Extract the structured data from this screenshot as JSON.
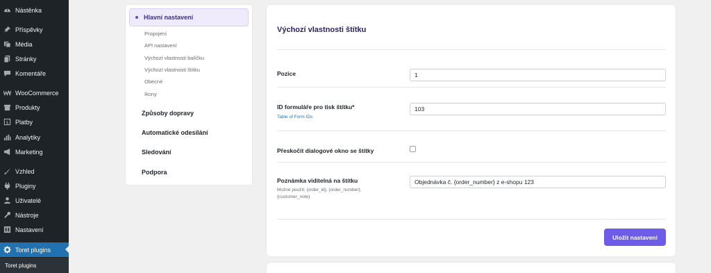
{
  "sidebar": {
    "items": [
      {
        "label": "Nástěnka",
        "icon": "dashboard-icon"
      },
      {
        "label": "Příspěvky",
        "icon": "pin-icon"
      },
      {
        "label": "Média",
        "icon": "media-icon"
      },
      {
        "label": "Stránky",
        "icon": "pages-icon"
      },
      {
        "label": "Komentáře",
        "icon": "comments-icon"
      },
      {
        "label": "WooCommerce",
        "icon": "woocommerce-icon"
      },
      {
        "label": "Produkty",
        "icon": "products-icon"
      },
      {
        "label": "Platby",
        "icon": "payments-icon"
      },
      {
        "label": "Analytiky",
        "icon": "analytics-icon"
      },
      {
        "label": "Marketing",
        "icon": "megaphone-icon"
      },
      {
        "label": "Vzhled",
        "icon": "brush-icon"
      },
      {
        "label": "Pluginy",
        "icon": "plugins-icon"
      },
      {
        "label": "Uživatelé",
        "icon": "users-icon"
      },
      {
        "label": "Nástroje",
        "icon": "tools-icon"
      },
      {
        "label": "Nastavení",
        "icon": "settings-icon"
      },
      {
        "label": "Toret plugins",
        "icon": "gear-icon"
      }
    ],
    "submenu_label": "Toret plugins",
    "active_color": "#2271b1"
  },
  "settings_nav": {
    "active_label": "Hlavní nastavení",
    "sub_items": [
      "Propojení",
      "API nastavení",
      "Výchozí vlastnosti balíčku",
      "Výchozí vlastnosti štítku",
      "Obecné",
      "Ikony"
    ],
    "main_items": [
      "Způsoby dopravy",
      "Automatické odesílání",
      "Sledování",
      "Podpora"
    ]
  },
  "form": {
    "title": "Výchozí vlastnosti štítku",
    "position": {
      "label": "Pozice",
      "value": "1"
    },
    "form_id": {
      "label": "ID formuláře pro tisk štítku*",
      "link": "Table of Form IDs",
      "value": "103"
    },
    "skip_dialog": {
      "label": "Přeskočit dialogové okno se štítky",
      "checked": false
    },
    "note": {
      "label": "Poznámka viditelná na štítku",
      "help": "Možné použít: {order_id}, {order_number}, {customer_note}",
      "value": "Objednávka č. {order_number} z e-shopu 123"
    },
    "save_label": "Uložit nastavení",
    "accent": "#6c5ce7"
  }
}
